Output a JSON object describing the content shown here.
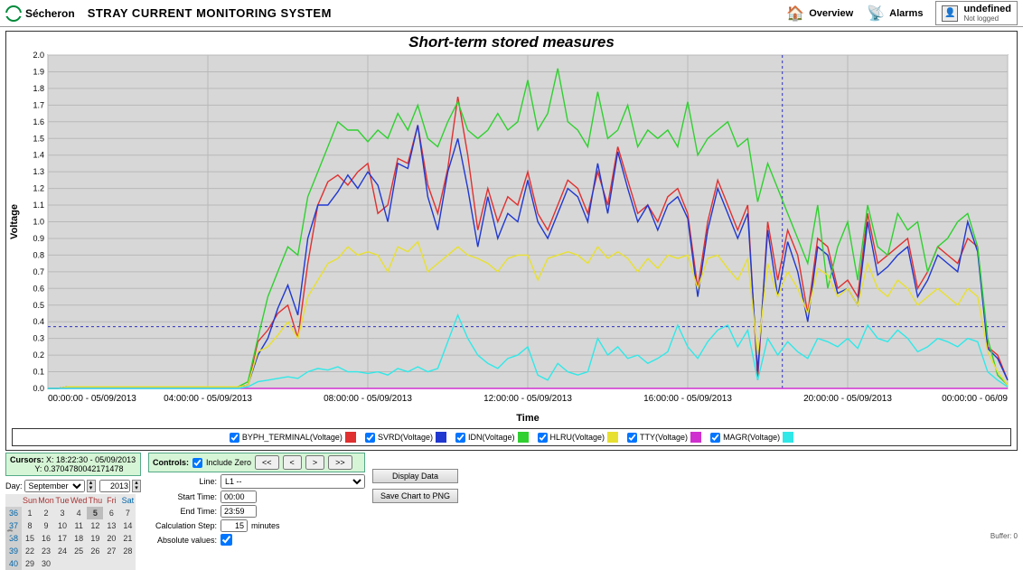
{
  "brand": "Sécheron",
  "app_title": "STRAY CURRENT MONITORING SYSTEM",
  "nav": {
    "overview": "Overview",
    "alarms": "Alarms"
  },
  "user": {
    "name": "undefined",
    "status": "Not logged"
  },
  "cursors_label": "Cursors:",
  "cursor_x": "X: 18:22:30 - 05/09/2013",
  "cursor_y": "Y: 0.3704780042171478",
  "controls": {
    "label": "Controls:",
    "include_zero_label": "Include Zero",
    "btn_first": "<<",
    "btn_prev": "<",
    "btn_next": ">",
    "btn_last": ">>"
  },
  "calendar": {
    "day_label": "Day:",
    "month": "September",
    "year": "2013",
    "dow": [
      "Sun",
      "Mon",
      "Tue",
      "Wed",
      "Thu",
      "Fri",
      "Sat"
    ],
    "weeks": [
      {
        "wk": "36",
        "days": [
          "1",
          "2",
          "3",
          "4",
          "5",
          "6",
          "7"
        ],
        "sel_idx": 4
      },
      {
        "wk": "37",
        "days": [
          "8",
          "9",
          "10",
          "11",
          "12",
          "13",
          "14"
        ]
      },
      {
        "wk": "38",
        "days": [
          "15",
          "16",
          "17",
          "18",
          "19",
          "20",
          "21"
        ]
      },
      {
        "wk": "39",
        "days": [
          "22",
          "23",
          "24",
          "25",
          "26",
          "27",
          "28"
        ]
      },
      {
        "wk": "40",
        "days": [
          "29",
          "30",
          "",
          "",
          "",
          "",
          ""
        ]
      }
    ]
  },
  "form": {
    "line_label": "Line:",
    "line_value": "L1 --",
    "start_label": "Start Time:",
    "start_value": "00:00",
    "end_label": "End Time:",
    "end_value": "23:59",
    "step_label": "Calculation Step:",
    "step_value": "15",
    "step_unit": "minutes",
    "abs_label": "Absolute values:"
  },
  "buttons": {
    "display": "Display Data",
    "save": "Save Chart to PNG"
  },
  "footer_buffer": "Buffer: 0",
  "chart_data": {
    "type": "line",
    "title": "Short-term stored measures",
    "xlabel": "Time",
    "ylabel": "Voltage",
    "ylim": [
      0,
      2.0
    ],
    "yticks": [
      0.0,
      0.1,
      0.2,
      0.3,
      0.4,
      0.5,
      0.6,
      0.7,
      0.8,
      0.9,
      1.0,
      1.1,
      1.2,
      1.3,
      1.4,
      1.5,
      1.6,
      1.7,
      1.8,
      1.9,
      2.0
    ],
    "x_tick_labels": [
      "00:00:00 - 05/09/2013",
      "04:00:00 - 05/09/2013",
      "08:00:00 - 05/09/2013",
      "12:00:00 - 05/09/2013",
      "16:00:00 - 05/09/2013",
      "20:00:00 - 05/09/2013",
      "00:00:00 - 06/09"
    ],
    "cursor_x_minute": 1102,
    "cursor_y_value": 0.3704780042171478,
    "series": [
      {
        "name": "BYPH_TERMINAL(Voltage)",
        "color": "#e03030",
        "values": [
          0.0,
          0.0,
          0.01,
          0.01,
          0.01,
          0.01,
          0.01,
          0.01,
          0.01,
          0.01,
          0.01,
          0.01,
          0.01,
          0.01,
          0.01,
          0.01,
          0.01,
          0.01,
          0.01,
          0.01,
          0.02,
          0.28,
          0.35,
          0.45,
          0.5,
          0.3,
          0.75,
          1.1,
          1.24,
          1.28,
          1.22,
          1.3,
          1.35,
          1.05,
          1.1,
          1.38,
          1.35,
          1.58,
          1.22,
          1.05,
          1.32,
          1.75,
          1.4,
          0.95,
          1.2,
          1.0,
          1.15,
          1.1,
          1.3,
          1.05,
          0.95,
          1.1,
          1.25,
          1.2,
          1.05,
          1.3,
          1.1,
          1.45,
          1.25,
          1.05,
          1.1,
          1.0,
          1.15,
          1.2,
          1.05,
          0.6,
          1.0,
          1.25,
          1.1,
          0.95,
          1.1,
          0.05,
          1.0,
          0.65,
          0.95,
          0.8,
          0.45,
          0.9,
          0.85,
          0.6,
          0.65,
          0.55,
          1.05,
          0.75,
          0.8,
          0.85,
          0.9,
          0.6,
          0.7,
          0.85,
          0.8,
          0.75,
          0.9,
          0.85,
          0.25,
          0.2,
          0.05
        ]
      },
      {
        "name": "SVRD(Voltage)",
        "color": "#2038d0",
        "values": [
          0.0,
          0.0,
          0.01,
          0.01,
          0.01,
          0.01,
          0.01,
          0.01,
          0.01,
          0.01,
          0.01,
          0.01,
          0.01,
          0.01,
          0.01,
          0.01,
          0.01,
          0.01,
          0.01,
          0.01,
          0.02,
          0.2,
          0.3,
          0.48,
          0.62,
          0.44,
          0.9,
          1.1,
          1.1,
          1.18,
          1.28,
          1.2,
          1.3,
          1.22,
          1.0,
          1.35,
          1.32,
          1.58,
          1.15,
          0.95,
          1.3,
          1.5,
          1.2,
          0.85,
          1.15,
          0.9,
          1.05,
          1.0,
          1.25,
          1.0,
          0.9,
          1.05,
          1.2,
          1.15,
          1.0,
          1.35,
          1.05,
          1.42,
          1.2,
          1.0,
          1.1,
          0.95,
          1.1,
          1.15,
          1.02,
          0.55,
          0.95,
          1.2,
          1.05,
          0.9,
          1.05,
          0.1,
          0.95,
          0.55,
          0.88,
          0.7,
          0.4,
          0.85,
          0.8,
          0.57,
          0.6,
          0.5,
          1.0,
          0.68,
          0.73,
          0.8,
          0.85,
          0.55,
          0.65,
          0.8,
          0.75,
          0.7,
          1.0,
          0.82,
          0.24,
          0.18,
          0.05
        ]
      },
      {
        "name": "IDN(Voltage)",
        "color": "#30d030",
        "values": [
          0.0,
          0.0,
          0.01,
          0.01,
          0.01,
          0.01,
          0.01,
          0.01,
          0.01,
          0.01,
          0.01,
          0.01,
          0.01,
          0.01,
          0.01,
          0.01,
          0.01,
          0.01,
          0.01,
          0.01,
          0.04,
          0.3,
          0.55,
          0.7,
          0.85,
          0.8,
          1.15,
          1.3,
          1.45,
          1.6,
          1.55,
          1.55,
          1.48,
          1.55,
          1.5,
          1.65,
          1.55,
          1.7,
          1.5,
          1.45,
          1.6,
          1.72,
          1.55,
          1.5,
          1.55,
          1.65,
          1.55,
          1.6,
          1.85,
          1.55,
          1.65,
          1.92,
          1.6,
          1.55,
          1.45,
          1.78,
          1.5,
          1.55,
          1.7,
          1.45,
          1.55,
          1.5,
          1.55,
          1.45,
          1.72,
          1.4,
          1.5,
          1.55,
          1.6,
          1.45,
          1.5,
          1.12,
          1.35,
          1.2,
          1.05,
          0.9,
          0.75,
          1.1,
          0.6,
          0.85,
          1.0,
          0.65,
          1.1,
          0.85,
          0.8,
          1.05,
          0.95,
          1.0,
          0.7,
          0.85,
          0.9,
          1.0,
          1.05,
          0.85,
          0.3,
          0.08,
          0.02
        ]
      },
      {
        "name": "HLRU(Voltage)",
        "color": "#e8e030",
        "values": [
          0.0,
          0.0,
          0.01,
          0.01,
          0.01,
          0.01,
          0.01,
          0.01,
          0.01,
          0.01,
          0.01,
          0.01,
          0.01,
          0.01,
          0.01,
          0.01,
          0.01,
          0.01,
          0.01,
          0.01,
          0.02,
          0.22,
          0.25,
          0.32,
          0.4,
          0.3,
          0.55,
          0.65,
          0.75,
          0.78,
          0.85,
          0.8,
          0.82,
          0.8,
          0.7,
          0.85,
          0.82,
          0.88,
          0.7,
          0.75,
          0.8,
          0.85,
          0.8,
          0.78,
          0.75,
          0.7,
          0.78,
          0.8,
          0.8,
          0.65,
          0.78,
          0.8,
          0.82,
          0.8,
          0.75,
          0.85,
          0.78,
          0.82,
          0.78,
          0.7,
          0.78,
          0.72,
          0.8,
          0.78,
          0.8,
          0.6,
          0.78,
          0.8,
          0.72,
          0.65,
          0.78,
          0.2,
          0.75,
          0.55,
          0.7,
          0.6,
          0.45,
          0.72,
          0.68,
          0.55,
          0.6,
          0.5,
          0.75,
          0.6,
          0.55,
          0.65,
          0.6,
          0.5,
          0.55,
          0.6,
          0.55,
          0.5,
          0.6,
          0.55,
          0.22,
          0.1,
          0.02
        ]
      },
      {
        "name": "TTY(Voltage)",
        "color": "#d030d0",
        "values": [
          0.0,
          0.0,
          0.0,
          0.0,
          0.0,
          0.0,
          0.0,
          0.0,
          0.0,
          0.0,
          0.0,
          0.0,
          0.0,
          0.0,
          0.0,
          0.0,
          0.0,
          0.0,
          0.0,
          0.0,
          0.0,
          0.0,
          0.0,
          0.0,
          0.0,
          0.0,
          0.0,
          0.0,
          0.0,
          0.0,
          0.0,
          0.0,
          0.0,
          0.0,
          0.0,
          0.0,
          0.0,
          0.0,
          0.0,
          0.0,
          0.0,
          0.0,
          0.0,
          0.0,
          0.0,
          0.0,
          0.0,
          0.0,
          0.0,
          0.0,
          0.0,
          0.0,
          0.0,
          0.0,
          0.0,
          0.0,
          0.0,
          0.0,
          0.0,
          0.0,
          0.0,
          0.0,
          0.0,
          0.0,
          0.0,
          0.0,
          0.0,
          0.0,
          0.0,
          0.0,
          0.0,
          0.0,
          0.0,
          0.0,
          0.0,
          0.0,
          0.0,
          0.0,
          0.0,
          0.0,
          0.0,
          0.0,
          0.0,
          0.0,
          0.0,
          0.0,
          0.0,
          0.0,
          0.0,
          0.0,
          0.0,
          0.0,
          0.0,
          0.0,
          0.0,
          0.0,
          0.0
        ]
      },
      {
        "name": "MAGR(Voltage)",
        "color": "#30e8e8",
        "values": [
          0.0,
          0.0,
          0.0,
          0.0,
          0.0,
          0.0,
          0.0,
          0.0,
          0.0,
          0.0,
          0.0,
          0.0,
          0.0,
          0.0,
          0.0,
          0.0,
          0.0,
          0.0,
          0.0,
          0.0,
          0.01,
          0.04,
          0.05,
          0.06,
          0.07,
          0.06,
          0.1,
          0.12,
          0.11,
          0.13,
          0.1,
          0.1,
          0.09,
          0.1,
          0.08,
          0.12,
          0.1,
          0.13,
          0.1,
          0.12,
          0.28,
          0.44,
          0.3,
          0.2,
          0.15,
          0.12,
          0.18,
          0.2,
          0.25,
          0.08,
          0.05,
          0.15,
          0.1,
          0.08,
          0.1,
          0.3,
          0.2,
          0.25,
          0.18,
          0.2,
          0.15,
          0.18,
          0.22,
          0.38,
          0.25,
          0.18,
          0.28,
          0.35,
          0.38,
          0.25,
          0.35,
          0.05,
          0.3,
          0.2,
          0.28,
          0.22,
          0.18,
          0.3,
          0.28,
          0.25,
          0.3,
          0.24,
          0.38,
          0.3,
          0.28,
          0.35,
          0.3,
          0.22,
          0.25,
          0.3,
          0.28,
          0.25,
          0.3,
          0.28,
          0.1,
          0.05,
          0.01
        ]
      }
    ]
  }
}
